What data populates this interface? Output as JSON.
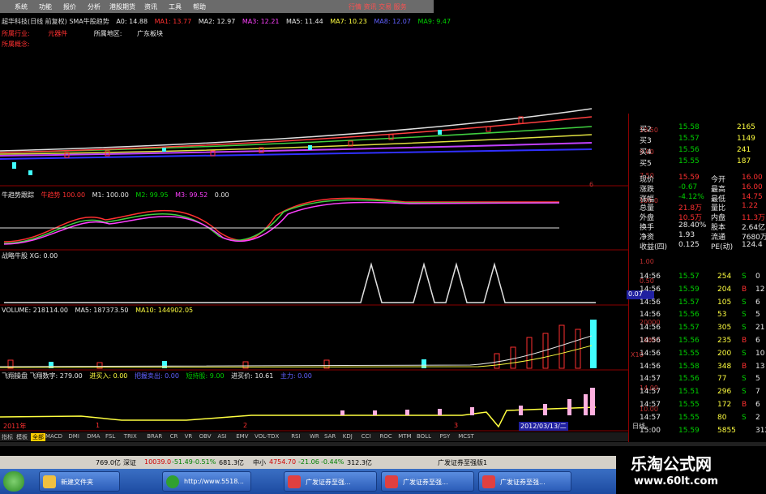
{
  "menu": {
    "items": [
      "系统",
      "功能",
      "报价",
      "分析",
      "港股期货",
      "资讯",
      "工具",
      "帮助"
    ],
    "right": "行情 资讯 交易 服务"
  },
  "header": {
    "title": "超华科技(日线 前复权) SMA牛股趋势",
    "ma_values": [
      "A0: 14.88",
      "MA1: 13.77",
      "MA2: 12.97",
      "MA3: 12.21",
      "MA5: 11.44",
      "MA7: 10.23",
      "MA8: 12.07",
      "MA9: 9.47"
    ],
    "industry_label": "所属行业:",
    "industry_value": "元器件",
    "region_label": "所属地区:",
    "region_value": "广东板块",
    "concept_label": "所属概念:"
  },
  "main_chart": {
    "annotations": [
      "死叉",
      "死叉",
      "死叉",
      "死叉",
      "死叉",
      "死叉",
      "死叉"
    ],
    "price_labels": [
      "7.43",
      "10.887",
      "11.824",
      "7.18",
      "13.170",
      "10.270"
    ]
  },
  "panel2": {
    "title": "牛趋势跟踪",
    "items": [
      "牛趋势 100.00",
      "M1: 100.00",
      "M2: 99.95",
      "M3: 99.52",
      "0.00"
    ],
    "axis": "100.0"
  },
  "panel3": {
    "title": "战略牛股 XG: 0.00",
    "axis": [
      "1.00",
      "0.50"
    ],
    "badge": "0.07"
  },
  "panel4": {
    "title": "VOLUME: 218114.00",
    "ma5": "MA5: 187373.50",
    "ma10": "MA10: 144902.05",
    "axis": [
      "20000",
      "10000",
      "X10"
    ]
  },
  "panel5": {
    "title": "飞翔操盘 飞翔数字: 279.00",
    "items": [
      "进买入: 0.00",
      "把握卖出: 0.00",
      "短持股: 9.00",
      "进买价: 10.61",
      "主力: 0.00"
    ],
    "axis": [
      "14.00",
      "10.00"
    ]
  },
  "date_axis": {
    "labels": [
      "2011年",
      "1",
      "2",
      "3"
    ],
    "current": "2012/03/13/二",
    "period": "日线"
  },
  "axis_main": [
    "10.50",
    "9.00",
    "7.50",
    "6"
  ],
  "quote": {
    "asks": [
      [
        "买2",
        "15.58",
        "2165"
      ],
      [
        "买3",
        "15.57",
        "1149"
      ],
      [
        "买4",
        "15.56",
        "241"
      ],
      [
        "买5",
        "15.55",
        "187"
      ]
    ],
    "stats": [
      [
        "现价",
        "15.59",
        "今开",
        "16.00"
      ],
      [
        "涨跌",
        "-0.67",
        "最高",
        "16.00"
      ],
      [
        "涨幅",
        "-4.12%",
        "最低",
        "14.75"
      ],
      [
        "总量",
        "21.8万",
        "量比",
        "1.22"
      ],
      [
        "外盘",
        "10.5万",
        "内盘",
        "11.3万"
      ],
      [
        "换手",
        "28.40%",
        "股本",
        "2.64亿"
      ],
      [
        "净资",
        "1.93",
        "流通",
        "7680万"
      ],
      [
        "收益(四)",
        "0.125",
        "PE(动)",
        "124.4"
      ]
    ],
    "ticks": [
      [
        "14:56",
        "15.57",
        "254",
        "S",
        "0"
      ],
      [
        "14:56",
        "15.59",
        "204",
        "B",
        "12"
      ],
      [
        "14:56",
        "15.57",
        "105",
        "S",
        "6"
      ],
      [
        "14:56",
        "15.56",
        "53",
        "S",
        "5"
      ],
      [
        "14:56",
        "15.57",
        "305",
        "S",
        "21"
      ],
      [
        "14:56",
        "15.56",
        "235",
        "B",
        "6"
      ],
      [
        "14:56",
        "15.55",
        "200",
        "S",
        "10"
      ],
      [
        "14:56",
        "15.58",
        "348",
        "B",
        "13"
      ],
      [
        "14:57",
        "15.56",
        "77",
        "S",
        "5"
      ],
      [
        "14:57",
        "15.51",
        "296",
        "S",
        "7"
      ],
      [
        "14:57",
        "15.55",
        "172",
        "B",
        "6"
      ],
      [
        "14:57",
        "15.55",
        "80",
        "S",
        "2"
      ],
      [
        "15:00",
        "15.59",
        "5855",
        "",
        "312"
      ]
    ]
  },
  "tabs": [
    "指标",
    "模板",
    "全部",
    "MACD",
    "DMI",
    "DMA",
    "FSL",
    "TRIX",
    "BRAR",
    "CR",
    "VR",
    "OBV",
    "ASI",
    "EMV",
    "VOL-TDX",
    "RSI",
    "WR",
    "SAR",
    "KDJ",
    "CCI",
    "ROC",
    "MTM",
    "BOLL",
    "PSY",
    "MCST"
  ],
  "status": {
    "items": [
      "769.0亿",
      "深证",
      "10039.0",
      "-51.49",
      "-0.51%",
      "681.3亿",
      "中小",
      "4754.70",
      "-21.06",
      "-0.44%",
      "312.3亿",
      "广发证券至强版1"
    ]
  },
  "taskbar": {
    "buttons": [
      "新建文件夹",
      "http://www.5518...",
      "广发证券至强...",
      "广发证券至强...",
      "广发证券至强..."
    ]
  },
  "watermark": {
    "line1": "乐淘公式网",
    "line2": "www.60lt.com"
  },
  "colors": {
    "up": "#ff3030",
    "down": "#40ffff",
    "grid": "#8b0000"
  }
}
